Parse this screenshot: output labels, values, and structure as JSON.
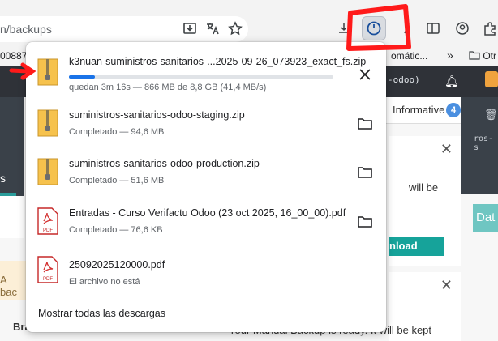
{
  "browser": {
    "url_fragment": "n/backups",
    "bookmark_left": "00887",
    "bookmark_text": "omátic...",
    "bookmark_folder": "Otr",
    "toolbar_icons": [
      "download-to-tray-icon",
      "translate-icon",
      "star-icon",
      "extensions-icon",
      "download-progress-icon",
      "sidebar-icon",
      "favorites-icon",
      "profile-icon",
      "puzzle-icon"
    ],
    "accent_color": "#1a73e8"
  },
  "background_page": {
    "nav_chip": "-odoo)",
    "tab_label": "Informative",
    "tab_badge": "4",
    "notification_text": "will be",
    "download_button": "nload",
    "dat_button": "Dat",
    "left_letter": "s",
    "backup_note": "A bac",
    "branch_label": "Bra",
    "mono_text": "ros-s",
    "bottom_text": "Your Manual Backup is ready. It will be kept",
    "teal_color": "#16a39a"
  },
  "downloads": {
    "items": [
      {
        "name": "k3nuan-suministros-sanitarios-...2025-09-26_073923_exact_fs.zip",
        "status": "quedan 3m 16s — 866 MB de 8,8 GB (41,4 MB/s)",
        "icon": "zip-file-icon",
        "action_icon": "cancel-icon",
        "progress": 0.098
      },
      {
        "name": "suministros-sanitarios-odoo-staging.zip",
        "status": "Completado — 94,6 MB",
        "icon": "zip-file-icon",
        "action_icon": "folder-icon"
      },
      {
        "name": "suministros-sanitarios-odoo-production.zip",
        "status": "Completado — 51,6 MB",
        "icon": "zip-file-icon",
        "action_icon": "folder-icon"
      },
      {
        "name": "Entradas - Curso Verifactu Odoo (23 oct 2025, 16_00_00).pdf",
        "status": "Completado — 76,6 KB",
        "icon": "pdf-file-icon",
        "action_icon": "folder-icon"
      },
      {
        "name": "25092025120000.pdf",
        "status": "El archivo no está",
        "icon": "pdf-file-icon",
        "action_icon": ""
      }
    ],
    "show_all_label": "Mostrar todas las descargas"
  },
  "annotations": {
    "color": "#ff1a1a"
  }
}
